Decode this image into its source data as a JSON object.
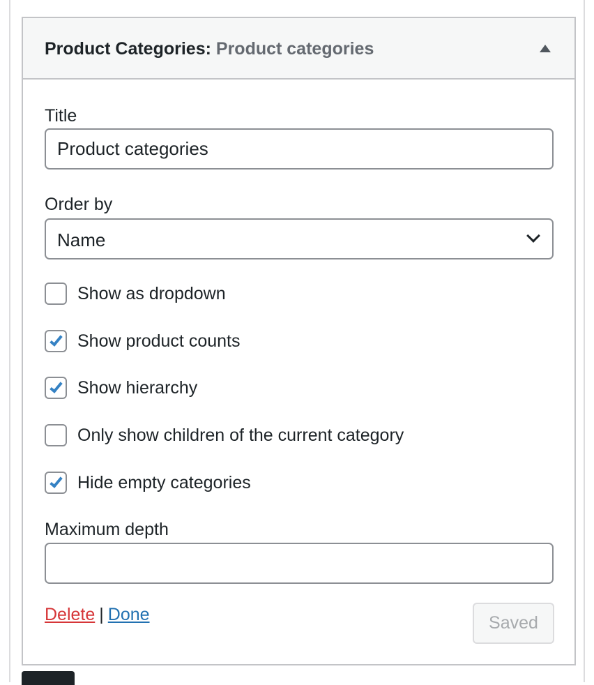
{
  "widget": {
    "name": "Product Categories",
    "separator": ":",
    "instance_title": "Product categories"
  },
  "fields": {
    "title_label": "Title",
    "title_value": "Product categories",
    "order_label": "Order by",
    "order_value": "Name",
    "depth_label": "Maximum depth",
    "depth_value": ""
  },
  "checkboxes": [
    {
      "label": "Show as dropdown",
      "checked": false
    },
    {
      "label": "Show product counts",
      "checked": true
    },
    {
      "label": "Show hierarchy",
      "checked": true
    },
    {
      "label": "Only show children of the current category",
      "checked": false
    },
    {
      "label": "Hide empty categories",
      "checked": true
    }
  ],
  "actions": {
    "delete_label": "Delete",
    "separator": "|",
    "done_label": "Done",
    "saved_label": "Saved"
  },
  "colors": {
    "accent": "#2271b1",
    "checkmark": "#3582c4",
    "delete": "#d63638"
  }
}
